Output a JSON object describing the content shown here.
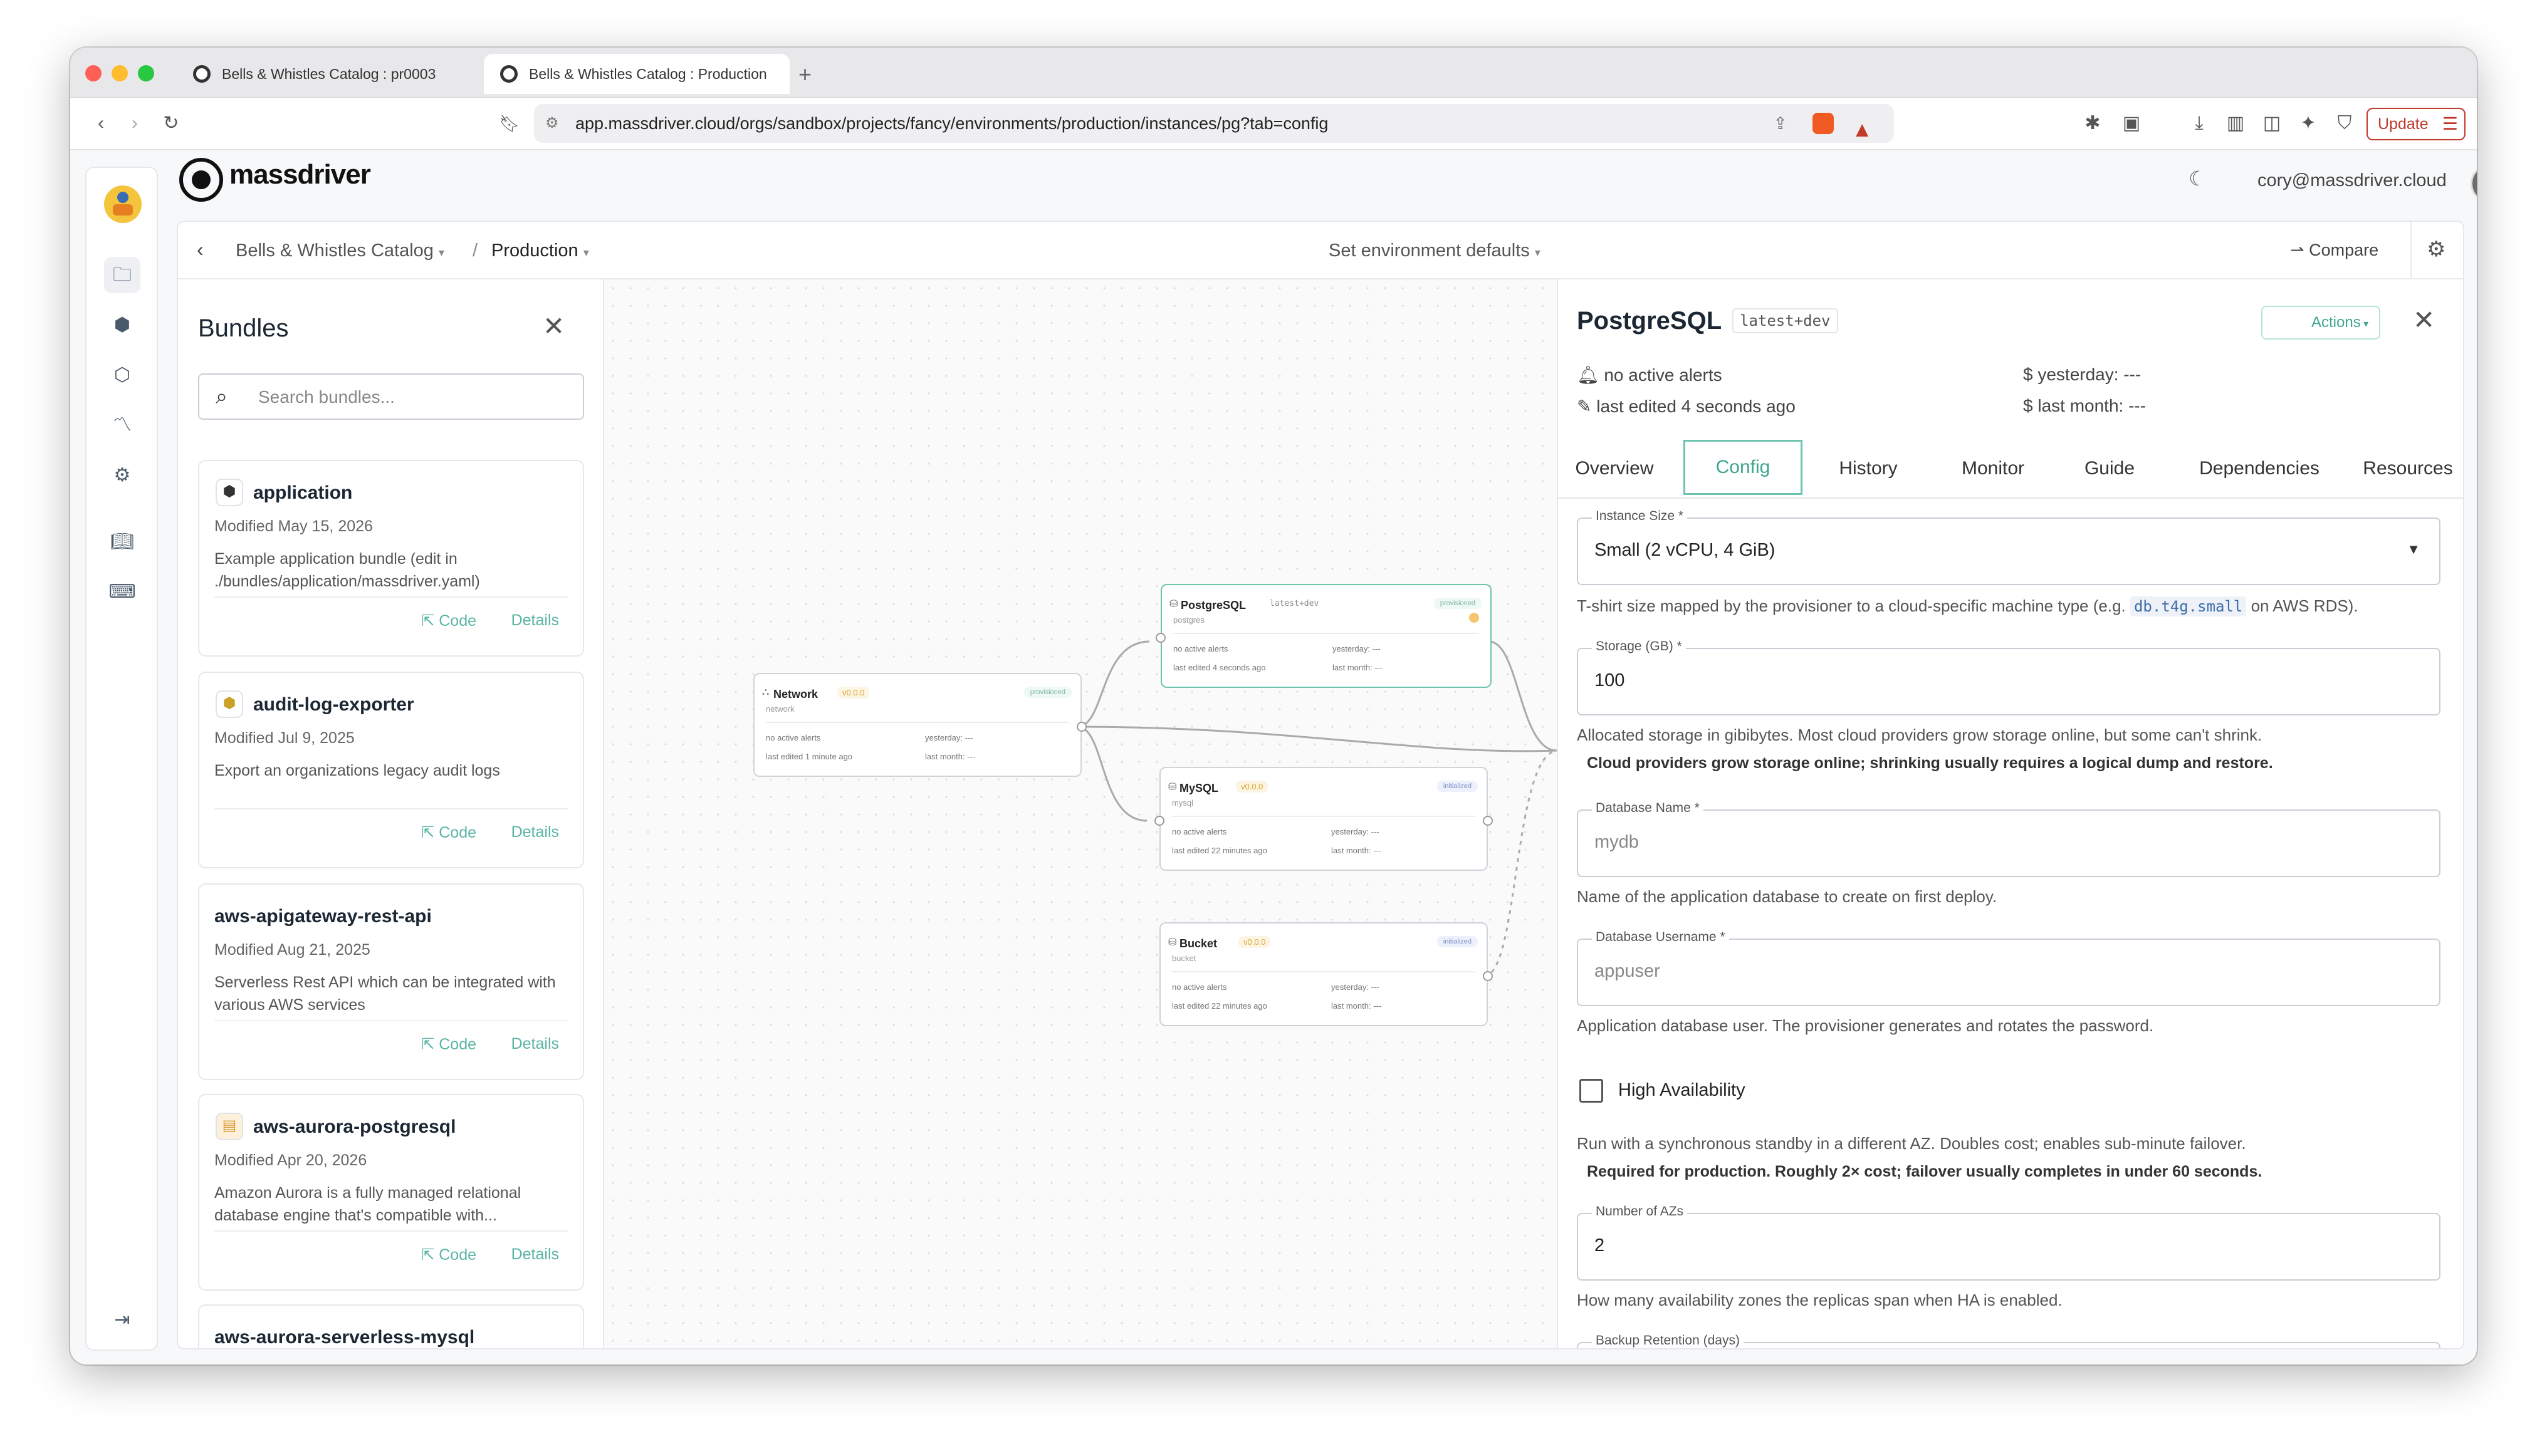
{
  "browser": {
    "tabs": [
      {
        "title": "Bells & Whistles Catalog : pr0003"
      },
      {
        "title": "Bells & Whistles Catalog : Production"
      }
    ],
    "url": "app.massdriver.cloud/orgs/sandbox/projects/fancy/environments/production/instances/pg?tab=config",
    "update_label": "Update"
  },
  "header": {
    "logo_text": "massdriver",
    "user_email": "cory@massdriver.cloud"
  },
  "crumbs": {
    "project": "Bells & Whistles Catalog",
    "separator": "/",
    "environment": "Production",
    "defaults": "Set environment defaults",
    "compare": "Compare"
  },
  "bundles": {
    "title": "Bundles",
    "search_placeholder": "Search bundles...",
    "code_label": "Code",
    "details_label": "Details",
    "items": [
      {
        "name": "application",
        "modified": "Modified May 15, 2026",
        "desc": "Example application bundle (edit in ./bundles/application/massdriver.yaml)"
      },
      {
        "name": "audit-log-exporter",
        "modified": "Modified Jul 9, 2025",
        "desc": "Export an organizations legacy audit logs"
      },
      {
        "name": "aws-apigateway-rest-api",
        "modified": "Modified Aug 21, 2025",
        "desc": "Serverless Rest API which can be integrated with various AWS services"
      },
      {
        "name": "aws-aurora-postgresql",
        "modified": "Modified Apr 20, 2026",
        "desc": "Amazon Aurora is a fully managed relational database engine that's compatible with..."
      },
      {
        "name": "aws-aurora-serverless-mysql",
        "modified": "",
        "desc": ""
      }
    ]
  },
  "canvas": {
    "nodes": {
      "network": {
        "title": "Network",
        "version": "v0.0.0",
        "status": "provisioned",
        "sub": "network",
        "alerts": "no active alerts",
        "edited": "last edited 1 minute ago",
        "yesterday": "yesterday: ---",
        "month": "last month: ---"
      },
      "postgres": {
        "title": "PostgreSQL",
        "version": "latest+dev",
        "status": "provisioned",
        "sub": "postgres",
        "alerts": "no active alerts",
        "edited": "last edited 4 seconds ago",
        "yesterday": "yesterday: ---",
        "month": "last month: ---"
      },
      "mysql": {
        "title": "MySQL",
        "version": "v0.0.0",
        "status": "initialized",
        "sub": "mysql",
        "alerts": "no active alerts",
        "edited": "last edited 22 minutes ago",
        "yesterday": "yesterday: ---",
        "month": "last month: ---"
      },
      "bucket": {
        "title": "Bucket",
        "version": "v0.0.0",
        "status": "initialized",
        "sub": "bucket",
        "alerts": "no active alerts",
        "edited": "last edited 22 minutes ago",
        "yesterday": "yesterday: ---",
        "month": "last month: ---"
      }
    }
  },
  "panel": {
    "title": "PostgreSQL",
    "version": "latest+dev",
    "actions_label": "Actions",
    "alerts": "no active alerts",
    "edited": "last edited 4 seconds ago",
    "yesterday": "yesterday: ---",
    "month": "last month: ---",
    "tabs": [
      "Overview",
      "Config",
      "History",
      "Monitor",
      "Guide",
      "Dependencies",
      "Resources"
    ],
    "active_tab": "Config",
    "fields": {
      "instance_size": {
        "label": "Instance Size *",
        "value": "Small (2 vCPU, 4 GiB)",
        "help_prefix": "T-shirt size mapped by the provisioner to a cloud-specific machine type (e.g. ",
        "help_code": "db.t4g.small",
        "help_suffix": " on AWS RDS)."
      },
      "storage": {
        "label": "Storage (GB) *",
        "value": "100",
        "help": "Allocated storage in gibibytes. Most cloud providers grow storage online, but some can't shrink.",
        "note": "Cloud providers grow storage online; shrinking usually requires a logical dump and restore."
      },
      "db_name": {
        "label": "Database Name *",
        "placeholder": "mydb",
        "help": "Name of the application database to create on first deploy."
      },
      "db_user": {
        "label": "Database Username *",
        "placeholder": "appuser",
        "help": "Application database user. The provisioner generates and rotates the password."
      },
      "ha": {
        "label": "High Availability",
        "checked": false,
        "help": "Run with a synchronous standby in a different AZ. Doubles cost; enables sub-minute failover.",
        "note": "Required for production. Roughly 2× cost; failover usually completes in under 60 seconds."
      },
      "azs": {
        "label": "Number of AZs",
        "value": "2",
        "help": "How many availability zones the replicas span when HA is enabled."
      },
      "backup": {
        "label": "Backup Retention (days)"
      }
    }
  },
  "colors": {
    "accent": "#5ab4a4",
    "update_border": "#c0392b",
    "link": "#5ab4a4"
  }
}
